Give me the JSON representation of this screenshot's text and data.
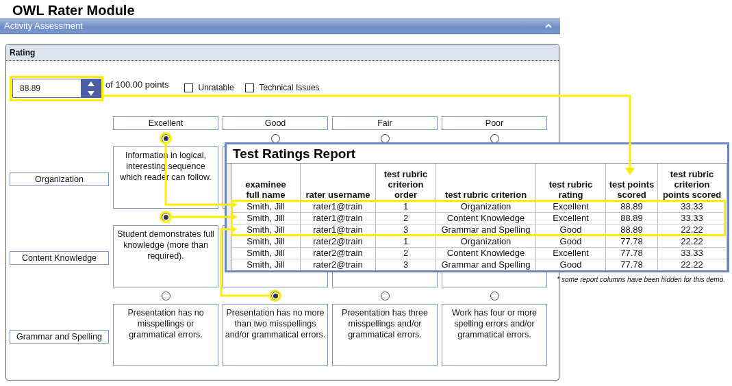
{
  "app_title": "OWL Rater Module",
  "section": {
    "title": "Activity Assessment",
    "expanded": true
  },
  "rating": {
    "title": "Rating",
    "score": "88.89",
    "max_text": "of 100.00 points",
    "checkboxes": [
      {
        "label": "Unratable",
        "checked": false
      },
      {
        "label": "Technical Issues",
        "checked": false
      }
    ],
    "levels": [
      "Excellent",
      "Good",
      "Fair",
      "Poor"
    ],
    "criteria": [
      {
        "name": "Organization",
        "options": [
          {
            "selected": true,
            "description": "Information in logical, interesting sequence which reader can follow."
          },
          {
            "selected": false
          },
          {
            "selected": false
          },
          {
            "selected": false
          }
        ]
      },
      {
        "name": "Content Knowledge",
        "options": [
          {
            "selected": true,
            "description": "Student demonstrates full knowledge (more than required)."
          }
        ]
      },
      {
        "name": "Grammar and Spelling",
        "options": [
          {
            "selected": false,
            "description": "Presentation has no misspellings or grammatical errors."
          },
          {
            "selected": true,
            "description": "Presentation has no more than two misspellings and/or grammatical errors."
          },
          {
            "selected": false,
            "description": "Presentation has three misspellings and/or grammatical errors."
          },
          {
            "selected": false,
            "description": "Work has four or more spelling errors and/or grammatical errors."
          }
        ]
      }
    ]
  },
  "report": {
    "title": "Test Ratings Report",
    "columns": [
      "examinee full name",
      "rater username",
      "test rubric criterion order",
      "test rubric criterion",
      "test rubric rating",
      "test points scored",
      "test rubric criterion points scored"
    ],
    "rows": [
      [
        "Smith, Jill",
        "rater1@train",
        "1",
        "Organization",
        "Excellent",
        "88.89",
        "33.33"
      ],
      [
        "Smith, Jill",
        "rater1@train",
        "2",
        "Content Knowledge",
        "Excellent",
        "88.89",
        "33.33"
      ],
      [
        "Smith, Jill",
        "rater1@train",
        "3",
        "Grammar and Spelling",
        "Good",
        "88.89",
        "22.22"
      ],
      [
        "Smith, Jill",
        "rater2@train",
        "1",
        "Organization",
        "Good",
        "77.78",
        "22.22"
      ],
      [
        "Smith, Jill",
        "rater2@train",
        "2",
        "Content Knowledge",
        "Excellent",
        "77.78",
        "33.33"
      ],
      [
        "Smith, Jill",
        "rater2@train",
        "3",
        "Grammar and Spelling",
        "Good",
        "77.78",
        "22.22"
      ]
    ],
    "note": "* some report columns have been hidden for this demo."
  }
}
